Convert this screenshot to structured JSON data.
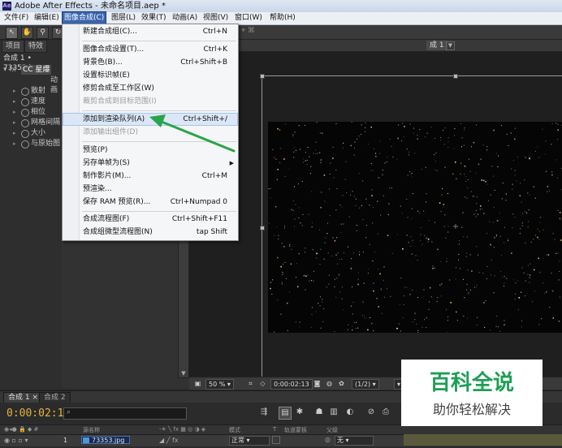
{
  "window": {
    "title": "Adobe After Effects - 未命名项目.aep *",
    "app_icon": "after-effects-logo",
    "logo_text": "Ae"
  },
  "menubar": {
    "items": [
      {
        "label": "文件(F)"
      },
      {
        "label": "编辑(E)"
      },
      {
        "label": "图像合成(C)",
        "active": true
      },
      {
        "label": "图层(L)"
      },
      {
        "label": "效果(T)"
      },
      {
        "label": "动画(A)"
      },
      {
        "label": "视图(V)"
      },
      {
        "label": "窗口(W)"
      },
      {
        "label": "帮助(H)"
      }
    ]
  },
  "dropdown": {
    "items": [
      {
        "label": "新建合成组(C)...",
        "shortcut": "Ctrl+N",
        "disabled": false
      },
      {
        "separator": true
      },
      {
        "label": "图像合成设置(T)...",
        "shortcut": "Ctrl+K",
        "disabled": false
      },
      {
        "label": "背景色(B)...",
        "shortcut": "Ctrl+Shift+B",
        "disabled": false
      },
      {
        "label": "设置标识帧(E)",
        "shortcut": "",
        "disabled": false
      },
      {
        "label": "修剪合成至工作区(W)",
        "shortcut": "",
        "disabled": false
      },
      {
        "label": "裁剪合成到目标范围(I)",
        "shortcut": "",
        "disabled": true
      },
      {
        "separator": true
      },
      {
        "label": "添加到渲染队列(A)",
        "shortcut": "Ctrl+Shift+/",
        "disabled": false,
        "highlighted": true
      },
      {
        "label": "添加输出组件(D)",
        "shortcut": "",
        "disabled": true
      },
      {
        "separator": true
      },
      {
        "label": "预览(P)",
        "shortcut": "",
        "disabled": false
      },
      {
        "label": "另存单帧为(S)",
        "shortcut": "",
        "disabled": false,
        "submenu": true
      },
      {
        "label": "制作影片(M)...",
        "shortcut": "Ctrl+M",
        "disabled": false
      },
      {
        "label": "预渲染...",
        "shortcut": "",
        "disabled": false
      },
      {
        "label": "保存 RAM 预览(R)...",
        "shortcut": "Ctrl+Numpad 0",
        "disabled": false
      },
      {
        "separator": true
      },
      {
        "label": "合成流程图(F)",
        "shortcut": "Ctrl+Shift+F11",
        "disabled": false
      },
      {
        "label": "合成组微型流程图(N)",
        "shortcut": "tap Shift",
        "disabled": false
      }
    ]
  },
  "left_panel": {
    "tabs": [
      {
        "label": "项目"
      },
      {
        "label": "特效"
      }
    ],
    "comp_label": "合成 1 • 73353.jpg",
    "effect_label": "CC 星爆",
    "sub_label": "动画",
    "properties": [
      {
        "label": "散射"
      },
      {
        "label": "速度"
      },
      {
        "label": "相位"
      },
      {
        "label": "网格间隔"
      },
      {
        "label": "大小"
      },
      {
        "label": "与原始图"
      }
    ]
  },
  "viewer": {
    "tab_label": "成 1",
    "tab_menu_symbol": "▼",
    "crosshair_symbol": "+",
    "zoom": "50 %",
    "timecode": "0:00:02:13",
    "resolution": "(1/2)"
  },
  "timeline": {
    "tabs": [
      {
        "label": "合成 1"
      },
      {
        "label": "合成 2"
      }
    ],
    "current_time": "0:00:02:13",
    "search_icon": "⌕",
    "header": {
      "source_name": "源名称",
      "mode": "模式",
      "track_matte": "轨道蒙板",
      "parent": "父级",
      "t_col": "T"
    },
    "layer": {
      "index": "1",
      "name": "73353.jpg",
      "mode": "正常",
      "parent": "无"
    }
  },
  "watermark": {
    "title": "百科全说",
    "subtitle": "助你轻松解决",
    "color": "#1e9e56"
  },
  "colors": {
    "accent": "#3a66b0",
    "timecode": "#e6b33c",
    "arrow": "#2aa44a"
  }
}
